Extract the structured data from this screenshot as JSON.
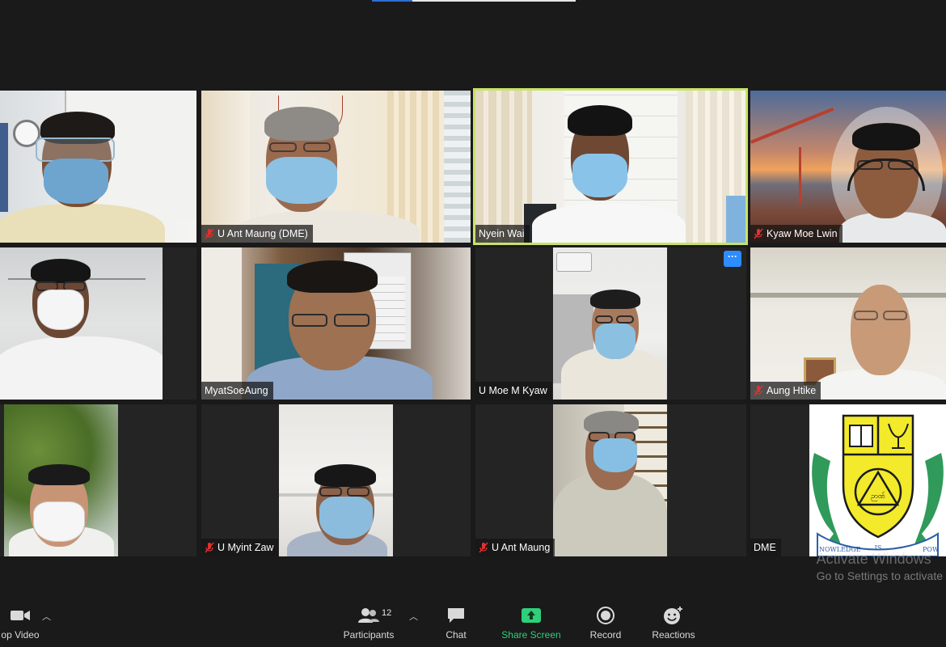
{
  "meeting": {
    "participants": [
      {
        "name": "",
        "muted": false
      },
      {
        "name": "U Ant Maung (DME)",
        "muted": true
      },
      {
        "name": "Nyein Wai",
        "muted": false,
        "active_speaker": true
      },
      {
        "name": "Kyaw Moe Lwin",
        "muted": true
      },
      {
        "name": "",
        "muted": false
      },
      {
        "name": "MyatSoeAung",
        "muted": false
      },
      {
        "name": "U Moe M Kyaw",
        "muted": false
      },
      {
        "name": "Aung Htike",
        "muted": true
      },
      {
        "name": "",
        "muted": false
      },
      {
        "name": "U Myint Zaw",
        "muted": true
      },
      {
        "name": "U Ant Maung",
        "muted": true
      },
      {
        "name": "DME",
        "muted": false
      }
    ],
    "more_button_label": "···"
  },
  "logo": {
    "motto_left": "NOWLEDGE",
    "motto_mid": "IS",
    "motto_right": "POW",
    "emblem_text": "ဉာဏ်"
  },
  "watermark": {
    "title": "Activate Windows",
    "subtitle": "Go to Settings to activate"
  },
  "toolbar": {
    "video_label": "op Video",
    "participants_label": "Participants",
    "participants_count": "12",
    "chat_label": "Chat",
    "share_label": "Share Screen",
    "record_label": "Record",
    "reactions_label": "Reactions"
  },
  "colors": {
    "active_speaker_border": "#c8e26a",
    "share_green": "#2fd07a",
    "more_button_blue": "#2d8cff",
    "muted_red": "#e0312f"
  }
}
